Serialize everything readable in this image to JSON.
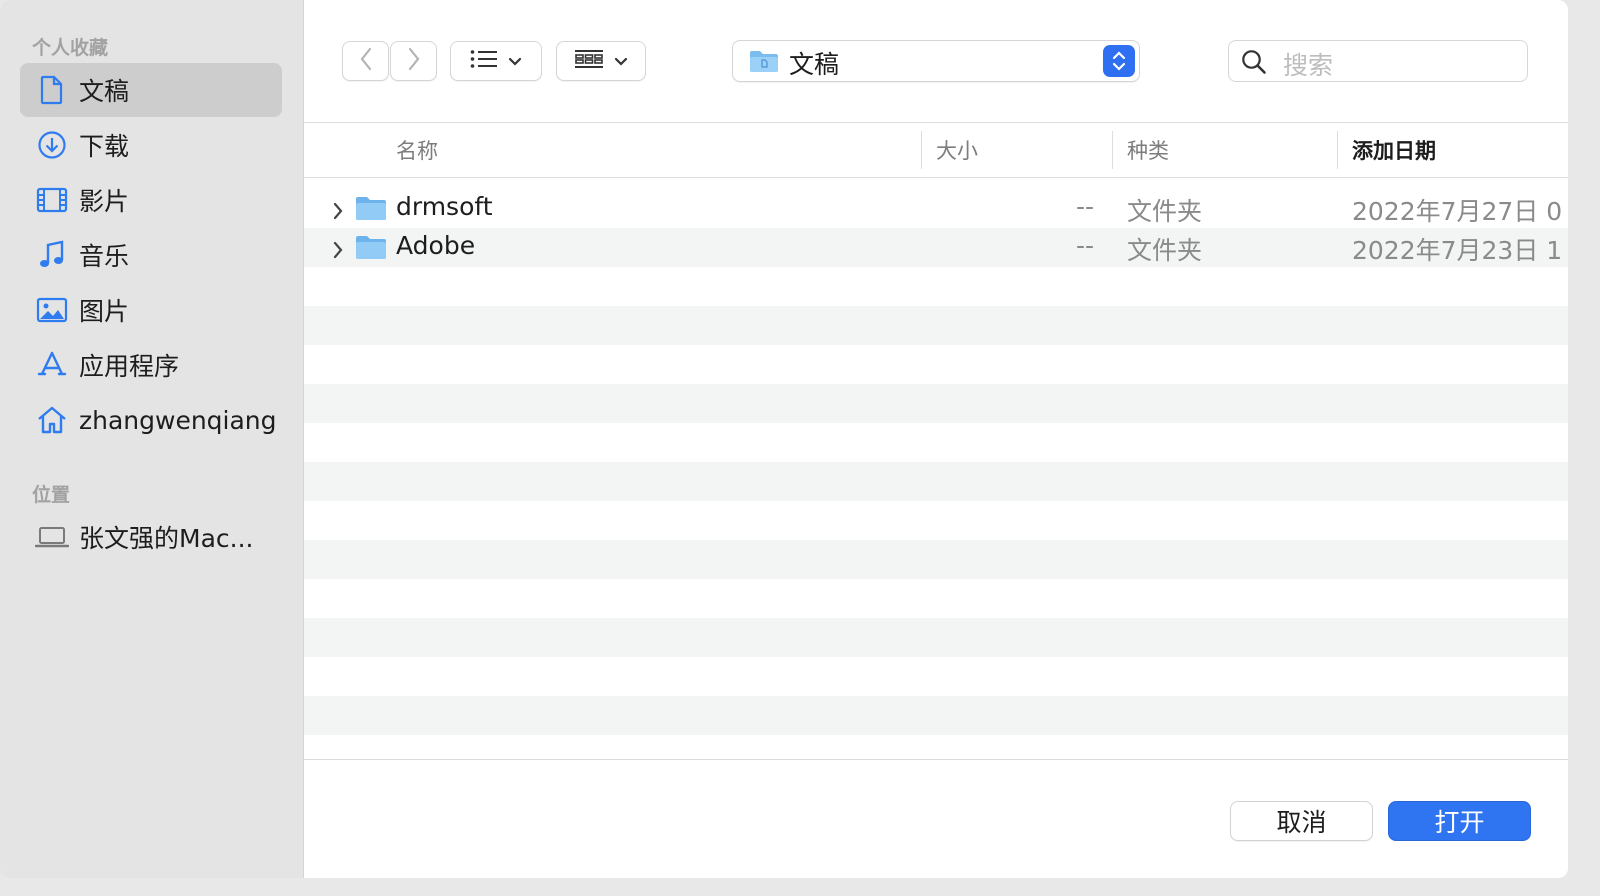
{
  "sidebar": {
    "favorites_title": "个人收藏",
    "locations_title": "位置",
    "favorites": [
      {
        "label": "文稿",
        "icon": "document-icon",
        "selected": true
      },
      {
        "label": "下载",
        "icon": "download-icon"
      },
      {
        "label": "影片",
        "icon": "film-icon"
      },
      {
        "label": "音乐",
        "icon": "music-icon"
      },
      {
        "label": "图片",
        "icon": "picture-icon"
      },
      {
        "label": "应用程序",
        "icon": "applications-icon"
      },
      {
        "label": "zhangwenqiang",
        "icon": "home-icon"
      }
    ],
    "locations": [
      {
        "label": "张文强的Mac...",
        "icon": "laptop-icon"
      }
    ]
  },
  "toolbar": {
    "path_label": "文稿",
    "search_placeholder": "搜索"
  },
  "columns": {
    "name": "名称",
    "size": "大小",
    "kind": "种类",
    "date_added": "添加日期"
  },
  "files": [
    {
      "name": "drmsoft",
      "size": "--",
      "kind": "文件夹",
      "date": "2022年7月27日 0"
    },
    {
      "name": "Adobe",
      "size": "--",
      "kind": "文件夹",
      "date": "2022年7月23日 1"
    }
  ],
  "footer": {
    "cancel_label": "取消",
    "open_label": "打开"
  },
  "colors": {
    "accent": "#2f74f0",
    "sidebar_bg": "#e4e4e4",
    "sidebar_icon": "#2f7bf0",
    "stripe": "#f3f4f4"
  }
}
